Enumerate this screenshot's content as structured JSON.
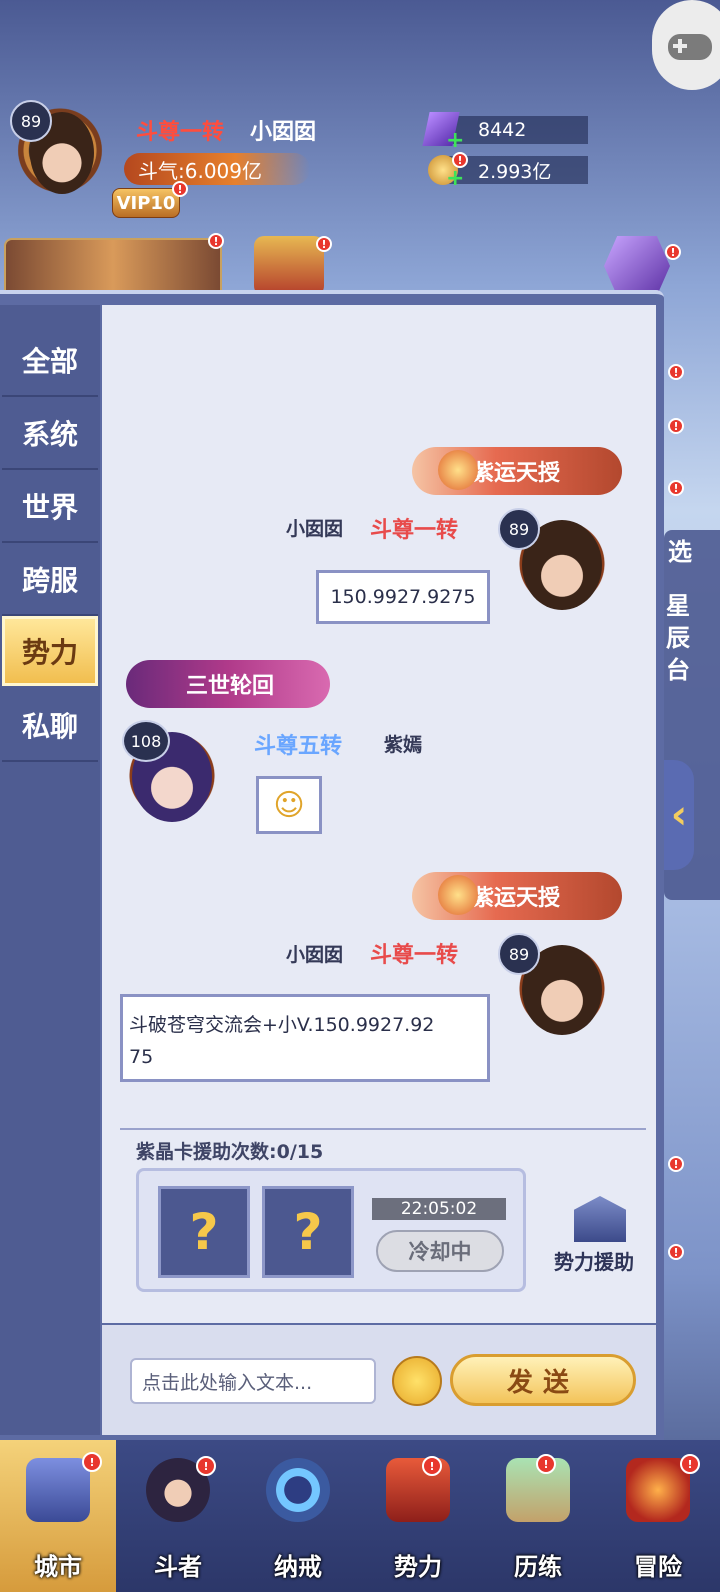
{
  "profile": {
    "level": "89",
    "rank": "斗尊一转",
    "name": "小囡囡",
    "power": "斗气:6.009亿",
    "vip": "VIP10"
  },
  "resources": {
    "crystals": "8442",
    "gold": "2.993亿"
  },
  "tabs": [
    "全部",
    "系统",
    "世界",
    "跨服",
    "势力",
    "私聊"
  ],
  "active_tab": "势力",
  "side": {
    "select": "选",
    "star_platform": "星辰台"
  },
  "messages": [
    {
      "title": "紫运天授",
      "name": "小囡囡",
      "rank": "斗尊一转",
      "level": "89",
      "text": "150.9927.9275"
    },
    {
      "title": "三世轮回",
      "name": "紫嫣",
      "rank": "斗尊五转",
      "level": "108",
      "text": ""
    },
    {
      "title": "紫运天授",
      "name": "小囡囡",
      "rank": "斗尊一转",
      "level": "89",
      "text_line1": "斗破苍穹交流会+小V.150.9927.92",
      "text_line2": "75"
    }
  ],
  "assist": {
    "count_label": "紫晶卡援助次数:0/15",
    "slot_mark": "?",
    "timer": "22:05:02",
    "cooldown": "冷却中",
    "button": "势力援助"
  },
  "input": {
    "placeholder": "点击此处输入文本...",
    "send": "发送"
  },
  "nav": [
    "城市",
    "斗者",
    "纳戒",
    "势力",
    "历练",
    "冒险"
  ],
  "colors": {
    "panel": "#5d6ba3",
    "chat_bg": "#e7eaf5",
    "rank_red": "#ff4d3d",
    "rank_blue": "#6aa6ff",
    "active_tab": "#f1be4f"
  }
}
